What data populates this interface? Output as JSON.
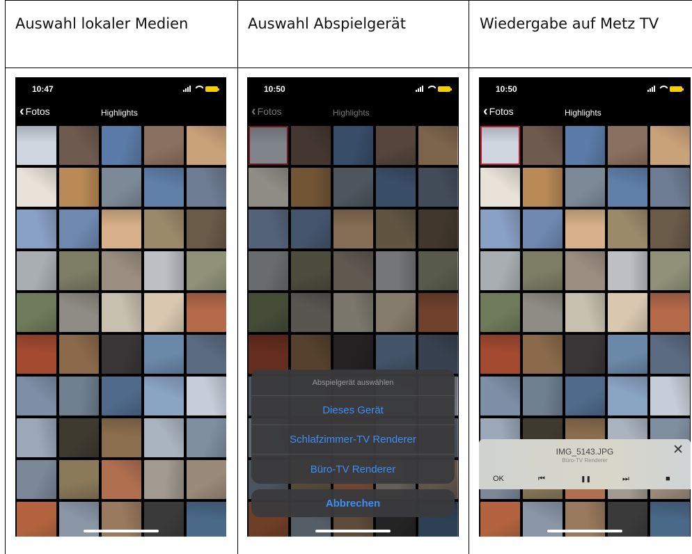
{
  "table": {
    "headers": [
      "Auswahl lokaler Medien",
      "Auswahl Abspielgerät",
      "Wiedergabe auf Metz TV"
    ]
  },
  "screens": [
    {
      "status_time": "10:47",
      "back_label": "Fotos",
      "nav_title": "Highlights"
    },
    {
      "status_time": "10:50",
      "back_label": "Fotos",
      "nav_title": "Highlights",
      "action_sheet": {
        "title": "Abspielgerät auswählen",
        "options": [
          "Dieses Gerät",
          "Schlafzimmer-TV Renderer",
          "Büro-TV Renderer"
        ],
        "cancel": "Abbrechen"
      }
    },
    {
      "status_time": "10:50",
      "back_label": "Fotos",
      "nav_title": "Highlights",
      "player": {
        "filename": "IMG_5143.JPG",
        "renderer": "Büro-TV Renderer",
        "ok_label": "OK",
        "close_glyph": "✕",
        "prev_glyph": "⏮",
        "pause_glyph": "❚❚",
        "next_glyph": "⏭",
        "stop_glyph": "■"
      }
    }
  ],
  "icons": [
    "chevron-left-icon",
    "signal-icon",
    "wifi-icon",
    "battery-icon",
    "close-icon",
    "previous-icon",
    "pause-icon",
    "next-icon",
    "stop-icon"
  ],
  "colors": {
    "selection": "#c42035",
    "action_blue": "#3d8ff5",
    "battery": "#f5d000"
  },
  "photo_colors": [
    [
      "#cfd6e0",
      "#6e5a4f",
      "#5b7ca8",
      "#8a7060",
      "#c9a27a"
    ],
    [
      "#e8e2d8",
      "#b98a55",
      "#7c8a98",
      "#5f7fa8",
      "#6d7c92"
    ],
    [
      "#8aa1c6",
      "#6f88b0",
      "#d8b18a",
      "#9b8a6a",
      "#6a5a48"
    ],
    [
      "#a9aeb2",
      "#7d7c64",
      "#9a8e80",
      "#bdbfc4",
      "#8f9278"
    ],
    [
      "#6f7a5a",
      "#8e8c84",
      "#c8c0ae",
      "#d8c8b0",
      "#b56a4a"
    ],
    [
      "#a34a30",
      "#8a6a4a",
      "#3a3638",
      "#6a88a8",
      "#5a6a80"
    ],
    [
      "#7d8fa6",
      "#6f8090",
      "#4f6a8a",
      "#8aa4c4",
      "#c6cdd8"
    ],
    [
      "#9aa8ba",
      "#3f3a30",
      "#8a6e4e",
      "#aab4c0",
      "#7f8fa0"
    ],
    [
      "#7a8898",
      "#8a7a5a",
      "#b07050",
      "#a09a90",
      "#9a8a7a"
    ],
    [
      "#b3643f",
      "#8a96a6",
      "#9a7a5e",
      "#3a3a3a",
      "#4a6888"
    ]
  ]
}
